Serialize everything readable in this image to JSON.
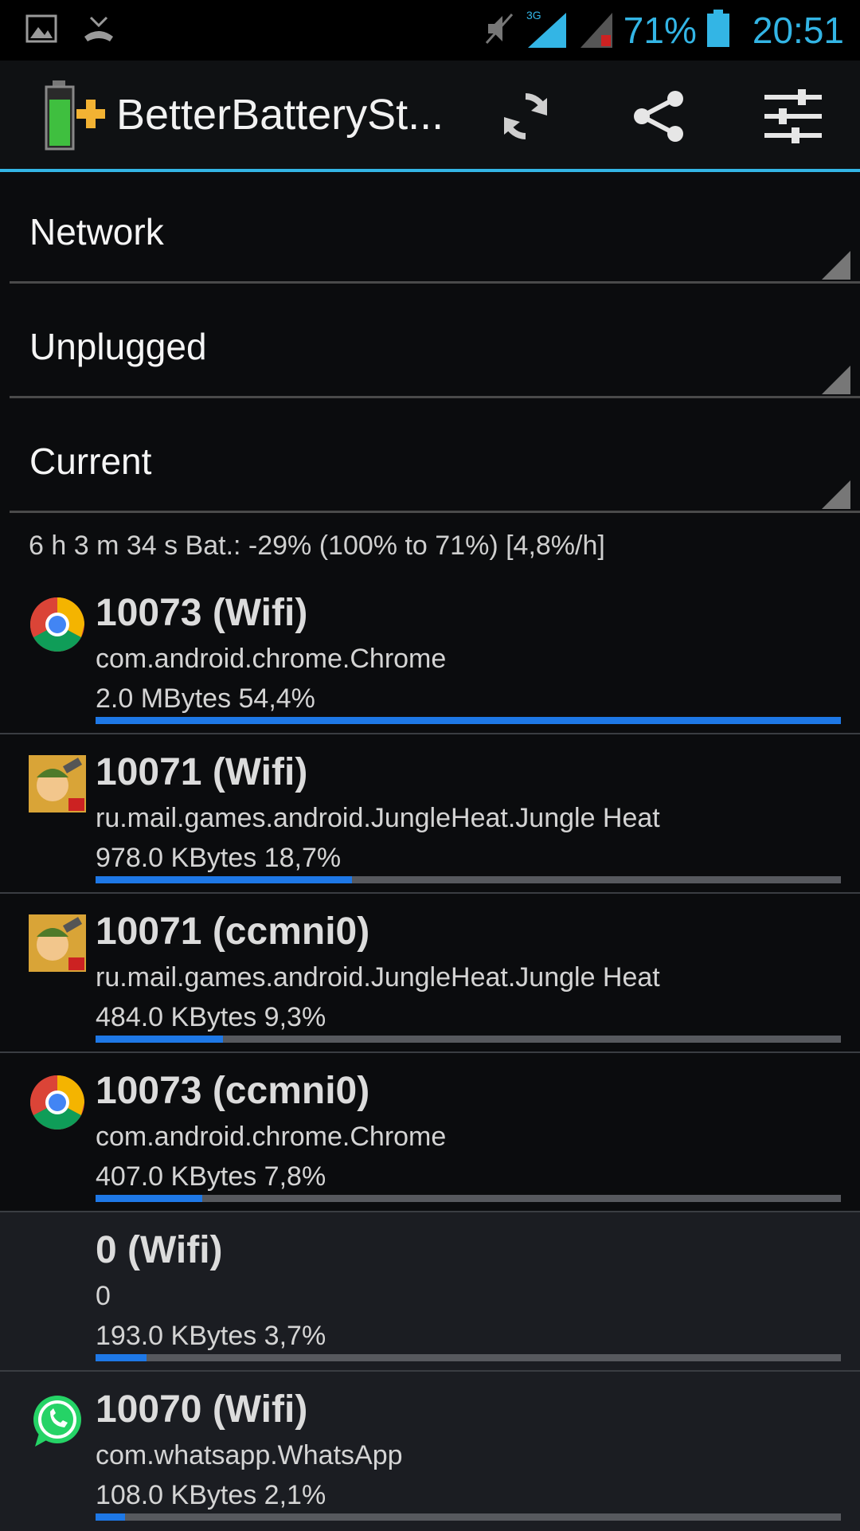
{
  "status_bar": {
    "battery_percent": "71%",
    "time": "20:51",
    "network_type": "3G",
    "accent": "#33b5e5",
    "icons": [
      "gallery-icon",
      "missed-call-icon",
      "mute-icon",
      "signal-3g-icon",
      "signal-sim2-icon",
      "battery-icon"
    ]
  },
  "action_bar": {
    "title": "BetterBatterySt...",
    "actions": [
      "refresh-icon",
      "share-icon",
      "settings-sliders-icon"
    ]
  },
  "spinners": [
    {
      "label": "Network"
    },
    {
      "label": "Unplugged"
    },
    {
      "label": "Current"
    }
  ],
  "summary": "6 h 3 m 34 s  Bat.: -29% (100% to 71%) [4,8%/h]",
  "entries": [
    {
      "title": "10073 (Wifi)",
      "package": "com.android.chrome.Chrome",
      "value": "2.0 MBytes 54,4%",
      "bar_fraction": 1.0,
      "icon": "chrome-icon"
    },
    {
      "title": "10071 (Wifi)",
      "package": "ru.mail.games.android.JungleHeat.Jungle Heat",
      "value": "978.0 KBytes 18,7%",
      "bar_fraction": 0.344,
      "icon": "jungle-heat-icon"
    },
    {
      "title": "10071 (ccmni0)",
      "package": "ru.mail.games.android.JungleHeat.Jungle Heat",
      "value": "484.0 KBytes 9,3%",
      "bar_fraction": 0.171,
      "icon": "jungle-heat-icon"
    },
    {
      "title": "10073 (ccmni0)",
      "package": "com.android.chrome.Chrome",
      "value": "407.0 KBytes 7,8%",
      "bar_fraction": 0.143,
      "icon": "chrome-icon"
    },
    {
      "title": "0 (Wifi)",
      "package": "0",
      "value": "193.0 KBytes 3,7%",
      "bar_fraction": 0.068,
      "icon": ""
    },
    {
      "title": "10070 (Wifi)",
      "package": "com.whatsapp.WhatsApp",
      "value": "108.0 KBytes 2,1%",
      "bar_fraction": 0.039,
      "icon": "whatsapp-icon"
    }
  ]
}
